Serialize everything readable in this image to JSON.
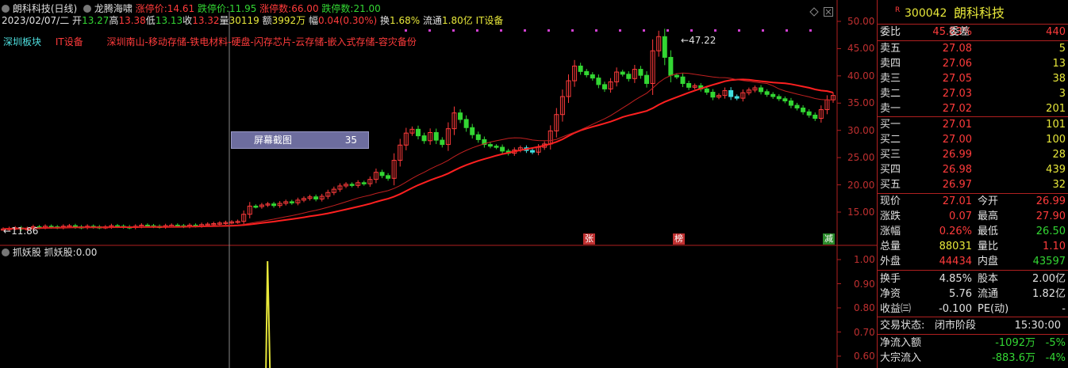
{
  "header": {
    "stock": "朗科科技(日线)",
    "indicator": "龙腾海啸",
    "up_limit_label": "涨停价:",
    "up_limit": "14.61",
    "down_limit_label": "跌停价:",
    "down_limit": "11.95",
    "up_count_label": "涨停数:",
    "up_count": "66.00",
    "down_count_label": "跌停数:",
    "down_count": "21.00"
  },
  "bar_info": {
    "date": "2023/02/07/二",
    "open_label": "开",
    "open": "13.27",
    "high_label": "高",
    "high": "13.38",
    "low_label": "低",
    "low": "13.13",
    "close_label": "收",
    "close": "13.32",
    "vol_label": "量",
    "vol": "30119",
    "amt_label": "额",
    "amt": "3992万",
    "amp_label": "幅",
    "amp": "0.04(0.30%)",
    "turn_label": "换",
    "turn": "1.68%",
    "float_label": "流通",
    "float": "1.80亿",
    "sector": "IT设备"
  },
  "board": {
    "label": "深圳板块",
    "sector": "IT设备",
    "concepts": "深圳南山-移动存储-铁电材料-硬盘-闪存芯片-云存储-嵌入式存储-容灾备份"
  },
  "tooltip": {
    "label": "屏幕截图",
    "value": "35"
  },
  "price_labels": {
    "high": "47.22",
    "low": "11.86"
  },
  "markers": {
    "zhang": "张",
    "bang": "榜",
    "jian": "减"
  },
  "y_axis": [
    "50.00",
    "45.00",
    "40.00",
    "35.00",
    "30.00",
    "25.00",
    "20.00",
    "15.00"
  ],
  "sub_panel": {
    "title": "抓妖股",
    "value_label": "抓妖股:",
    "value": "0.00",
    "y_axis": [
      "1.00",
      "0.90",
      "0.80",
      "0.70",
      "0.60"
    ]
  },
  "quote": {
    "badge": "R",
    "code": "300042",
    "name": "朗科科技",
    "weibi_label": "委比",
    "weibi": "45.83%",
    "weicha_label": "委差",
    "weicha": "440",
    "asks": [
      {
        "label": "卖五",
        "price": "27.08",
        "vol": "5"
      },
      {
        "label": "卖四",
        "price": "27.06",
        "vol": "13"
      },
      {
        "label": "卖三",
        "price": "27.05",
        "vol": "38"
      },
      {
        "label": "卖二",
        "price": "27.03",
        "vol": "3"
      },
      {
        "label": "卖一",
        "price": "27.02",
        "vol": "201"
      }
    ],
    "bids": [
      {
        "label": "买一",
        "price": "27.01",
        "vol": "101"
      },
      {
        "label": "买二",
        "price": "27.00",
        "vol": "100"
      },
      {
        "label": "买三",
        "price": "26.99",
        "vol": "28"
      },
      {
        "label": "买四",
        "price": "26.98",
        "vol": "439"
      },
      {
        "label": "买五",
        "price": "26.97",
        "vol": "32"
      }
    ],
    "stats": [
      {
        "l1": "现价",
        "v1": "27.01",
        "l2": "今开",
        "v2": "26.99"
      },
      {
        "l1": "涨跌",
        "v1": "0.07",
        "l2": "最高",
        "v2": "27.90"
      },
      {
        "l1": "涨幅",
        "v1": "0.26%",
        "l2": "最低",
        "v2": "26.50"
      },
      {
        "l1": "总量",
        "v1": "88031",
        "l2": "量比",
        "v2": "1.10"
      },
      {
        "l1": "外盘",
        "v1": "44434",
        "l2": "内盘",
        "v2": "43597"
      }
    ],
    "stats2": [
      {
        "l1": "换手",
        "v1": "4.85%",
        "l2": "股本",
        "v2": "2.00亿"
      },
      {
        "l1": "净资",
        "v1": "5.76",
        "l2": "流通",
        "v2": "1.82亿"
      },
      {
        "l1": "收益㈢",
        "v1": "-0.100",
        "l2": "PE(动)",
        "v2": "-"
      }
    ],
    "trade_status_label": "交易状态:",
    "trade_status": "闭市阶段",
    "trade_time": "15:30:00",
    "flows": [
      {
        "label": "净流入额",
        "value": "-1092万",
        "pct": "-5%"
      },
      {
        "label": "大宗流入",
        "value": "-883.6万",
        "pct": "-4%"
      }
    ]
  },
  "colors": {
    "up": "#ff3b3b",
    "down": "#33d633",
    "ma1": "#ff2020",
    "ma2": "#c02020",
    "axis": "#b02020"
  },
  "chart_data": {
    "type": "candlestick",
    "ylim": [
      10,
      52
    ],
    "closes": [
      11.9,
      12.0,
      12.1,
      11.9,
      12.0,
      12.3,
      12.2,
      12.4,
      12.3,
      12.2,
      12.4,
      12.5,
      12.3,
      12.2,
      12.4,
      12.3,
      12.2,
      12.3,
      12.5,
      12.4,
      12.3,
      12.2,
      12.4,
      12.6,
      12.5,
      12.4,
      12.3,
      12.5,
      12.6,
      12.5,
      12.4,
      12.6,
      12.5,
      12.7,
      12.8,
      12.9,
      13.0,
      13.1,
      13.2,
      13.3,
      14.6,
      16.1,
      16.0,
      16.3,
      16.5,
      16.2,
      16.6,
      16.9,
      16.7,
      17.2,
      17.5,
      17.8,
      17.4,
      17.9,
      18.6,
      19.2,
      19.8,
      20.1,
      19.9,
      20.4,
      20.2,
      21.0,
      22.3,
      21.7,
      21.2,
      24.5,
      27.3,
      29.5,
      30.2,
      29.0,
      28.1,
      29.6,
      28.2,
      27.4,
      30.3,
      33.2,
      32.0,
      30.5,
      29.2,
      28.3,
      27.4,
      27.1,
      26.9,
      26.2,
      25.8,
      26.4,
      26.8,
      26.3,
      26.0,
      26.9,
      27.5,
      29.9,
      32.9,
      36.2,
      39.1,
      41.8,
      40.8,
      40.2,
      39.6,
      38.4,
      37.6,
      38.9,
      40.7,
      40.3,
      39.5,
      41.2,
      40.1,
      38.6,
      44.6,
      47.2,
      43.4,
      40.1,
      39.8,
      38.6,
      37.9,
      38.2,
      37.6,
      37.0,
      36.1,
      36.4,
      37.3,
      36.2,
      35.9,
      36.9,
      37.4,
      37.8,
      37.1,
      36.6,
      36.2,
      35.8,
      35.4,
      34.6,
      34.1,
      33.4,
      32.8,
      32.2,
      33.8,
      35.6,
      36.4
    ],
    "ma_short_desc": "red moving average",
    "markers": [
      "张",
      "榜",
      "减"
    ],
    "sub_indicator": {
      "name": "抓妖股",
      "spike_index": 40,
      "spike_value": 1.0
    }
  }
}
